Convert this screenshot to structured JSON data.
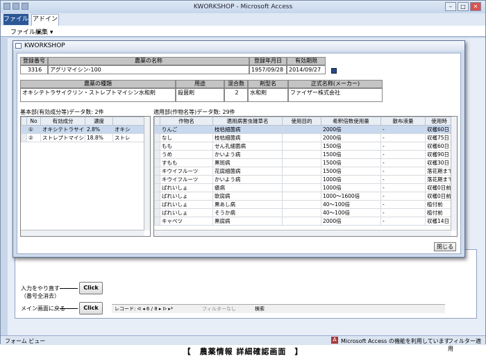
{
  "window": {
    "title": "KWORKSHOP - Microsoft Access",
    "min": "–",
    "max": "□",
    "close": "✕"
  },
  "ribbon": {
    "tab_file": "ファイル",
    "tab_addin": "アドイン",
    "menu_file": "ファイル ▾",
    "menu_edit": "編集 ▾"
  },
  "status": {
    "left": "フォーム ビュー",
    "access_msg": "Microsoft Access の機能を利用しています",
    "filter": "フィルター適用"
  },
  "caption": "【　農薬情報 詳細確認画面　】",
  "under_form": {
    "reset_label": "入力をやり直す\n（番号全消去）",
    "back_label": "メイン画面に戻る",
    "click_label": "Click",
    "nav_record": "レコード: ᐊ ◂ 6 / 8 ▸ ᐅ ▸*",
    "nav_filter": "フィルターなし",
    "nav_search": "検索"
  },
  "dialog": {
    "title": "KWORKSHOP",
    "headers1": {
      "reg_no": "登録番号",
      "name": "農薬の名称",
      "reg_date": "登録年月日",
      "expiry": "有効期限"
    },
    "values1": {
      "reg_no": "3316",
      "name": "アグリマイシン-100",
      "reg_date": "1957/09/28",
      "expiry": "2014/09/27"
    },
    "headers2": {
      "kind": "農薬の種類",
      "use": "用途",
      "mix": "混合数",
      "form": "剤型名",
      "maker": "正式名称(メーカー)"
    },
    "values2": {
      "kind": "オキシテトラサイクリン・ストレプトマイシン水和剤",
      "use": "殺菌剤",
      "mix": "2",
      "form": "水和剤",
      "maker": "ファイザー株式会社"
    },
    "left_title": "基本部(有効成分等)データ数: 2件",
    "left_cols": [
      "No",
      "有効成分",
      "濃度"
    ],
    "left_rows": [
      [
        "①",
        "オキシテトラサイクリン",
        "2.8%",
        "オキシ"
      ],
      [
        "②",
        "ストレプトマイシン硫酸塩",
        "18.8%",
        "ストレ"
      ]
    ],
    "right_title": "適用部(作物名等)データ数: 29件",
    "right_cols": [
      "作物名",
      "適用病害虫雑草名",
      "使用目的",
      "希釈倍数使用量",
      "散布液量",
      "使用時"
    ],
    "right_rows": [
      [
        "りんご",
        "枝枯細菌病",
        "",
        "2000倍",
        "-",
        "収穫60日"
      ],
      [
        "なし",
        "枝枯細菌病",
        "",
        "2000倍",
        "-",
        "収穫75日"
      ],
      [
        "もも",
        "せん孔細菌病",
        "",
        "1500倍",
        "-",
        "収穫60日"
      ],
      [
        "うめ",
        "かいよう病",
        "",
        "1500倍",
        "-",
        "収穫90日"
      ],
      [
        "すもも",
        "黒斑病",
        "",
        "1500倍",
        "-",
        "収穫30日"
      ],
      [
        "キウイフルーツ",
        "花腐細菌病",
        "",
        "1500倍",
        "-",
        "落花期まで"
      ],
      [
        "キウイフルーツ",
        "かいよう病",
        "",
        "1000倍",
        "-",
        "落花期まで"
      ],
      [
        "ばれいしょ",
        "瘡病",
        "",
        "1000倍",
        "-",
        "収穫0日前"
      ],
      [
        "ばれいしょ",
        "軟腐病",
        "",
        "1000〜1600倍",
        "-",
        "収穫0日前"
      ],
      [
        "ばれいしょ",
        "黒あし病",
        "",
        "40〜100倍",
        "-",
        "植付前"
      ],
      [
        "ばれいしょ",
        "そうか病",
        "",
        "40〜100倍",
        "-",
        "植付前"
      ],
      [
        "キャベツ",
        "黒腐病",
        "",
        "2000倍",
        "-",
        "収穫14日"
      ]
    ],
    "close_label": "閉じる"
  },
  "colors": {
    "ribbon_file": "#2b5797",
    "selection": "#c8d8ee",
    "header_gray": "#c4c4c4"
  }
}
